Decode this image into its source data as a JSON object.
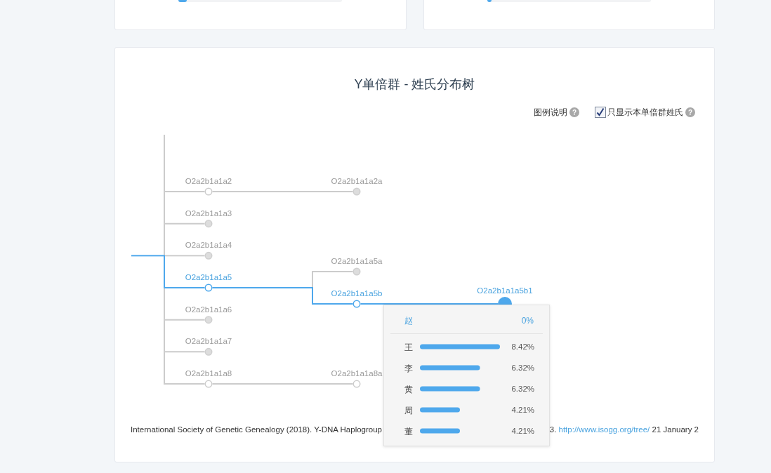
{
  "top_cards": [
    {
      "level": 0.05
    },
    {
      "level": 0.03
    }
  ],
  "panel": {
    "title": "Y单倍群 - 姓氏分布树"
  },
  "legend": {
    "label": "图例说明",
    "help": "?",
    "filter": {
      "label": "只显示本单倍群姓氏",
      "checked": true,
      "help": "?"
    }
  },
  "tree": {
    "root_on_path": true,
    "nodes": [
      {
        "label": "O2a2b1a1a2",
        "filled": false,
        "on_path": false,
        "selected": false,
        "children": [
          {
            "label": "O2a2b1a1a2a",
            "filled": true,
            "on_path": false,
            "selected": false
          }
        ]
      },
      {
        "label": "O2a2b1a1a3",
        "filled": true,
        "on_path": false,
        "selected": false
      },
      {
        "label": "O2a2b1a1a4",
        "filled": true,
        "on_path": false,
        "selected": false
      },
      {
        "label": "O2a2b1a1a5",
        "filled": false,
        "on_path": true,
        "selected": false,
        "children": [
          {
            "label": "O2a2b1a1a5a",
            "filled": true,
            "on_path": false,
            "selected": false
          },
          {
            "label": "O2a2b1a1a5b",
            "filled": false,
            "on_path": true,
            "selected": false,
            "children": [
              {
                "label": "O2a2b1a1a5b1",
                "filled": true,
                "on_path": true,
                "selected": true
              }
            ]
          }
        ]
      },
      {
        "label": "O2a2b1a1a6",
        "filled": true,
        "on_path": false,
        "selected": false
      },
      {
        "label": "O2a2b1a1a7",
        "filled": true,
        "on_path": false,
        "selected": false
      },
      {
        "label": "O2a2b1a1a8",
        "filled": false,
        "on_path": false,
        "selected": false,
        "children": [
          {
            "label": "O2a2b1a1a8a",
            "filled": false,
            "on_path": false,
            "selected": false
          }
        ]
      }
    ]
  },
  "tooltip": {
    "highlight": {
      "surname": "赵",
      "percent": "0%"
    },
    "chart_data": {
      "type": "bar",
      "orientation": "horizontal",
      "categories": [
        "王",
        "李",
        "黄",
        "周",
        "董"
      ],
      "values": [
        8.42,
        6.32,
        6.32,
        4.21,
        4.21
      ],
      "value_labels": [
        "8.42%",
        "6.32%",
        "6.32%",
        "4.21%",
        "4.21%"
      ]
    }
  },
  "citation": {
    "text": "International Society of Genetic Genealogy (2018). Y-DNA Haplogroup",
    "tail_prefix": "3.",
    "link": "http://www.isogg.org/tree/",
    "tail": "21 January 2"
  }
}
